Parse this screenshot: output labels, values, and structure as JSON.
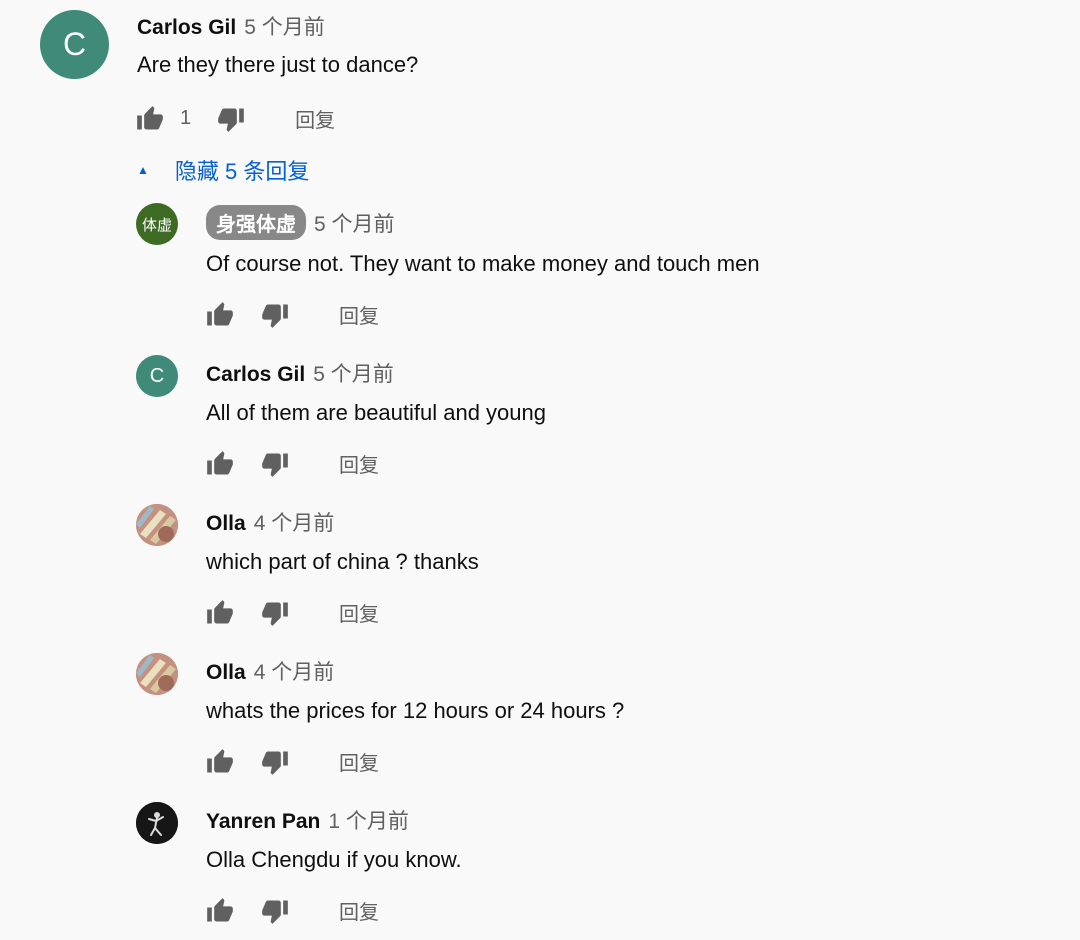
{
  "top_comment": {
    "author": "Carlos Gil",
    "time": "5 个月前",
    "avatar_letter": "C",
    "text": "Are they there just to dance?",
    "likes": "1",
    "reply_label": "回复"
  },
  "replies_toggle": {
    "label": "隐藏 5 条回复",
    "icon": "caret-up-icon"
  },
  "replies": [
    {
      "author": "身强体虚",
      "time": "5 个月前",
      "avatar_text": "体虚",
      "text": "Of course not. They want to make money and touch men",
      "reply_label": "回复"
    },
    {
      "author": "Carlos Gil",
      "time": "5 个月前",
      "avatar_text": "C",
      "text": "All of them are beautiful and young",
      "reply_label": "回复"
    },
    {
      "author": "Olla",
      "time": "4 个月前",
      "text": "which part of china ? thanks",
      "reply_label": "回复"
    },
    {
      "author": "Olla",
      "time": "4 个月前",
      "text": "whats the prices for 12 hours or 24 hours ?",
      "reply_label": "回复"
    },
    {
      "author": "Yanren Pan",
      "time": "1 个月前",
      "text": "Olla Chengdu if you know.",
      "reply_label": "回复"
    }
  ],
  "colors": {
    "background": "#f9f9f9",
    "link_blue": "#065fd4",
    "secondary_text": "#606060",
    "avatar_green": "#3f8a78"
  }
}
